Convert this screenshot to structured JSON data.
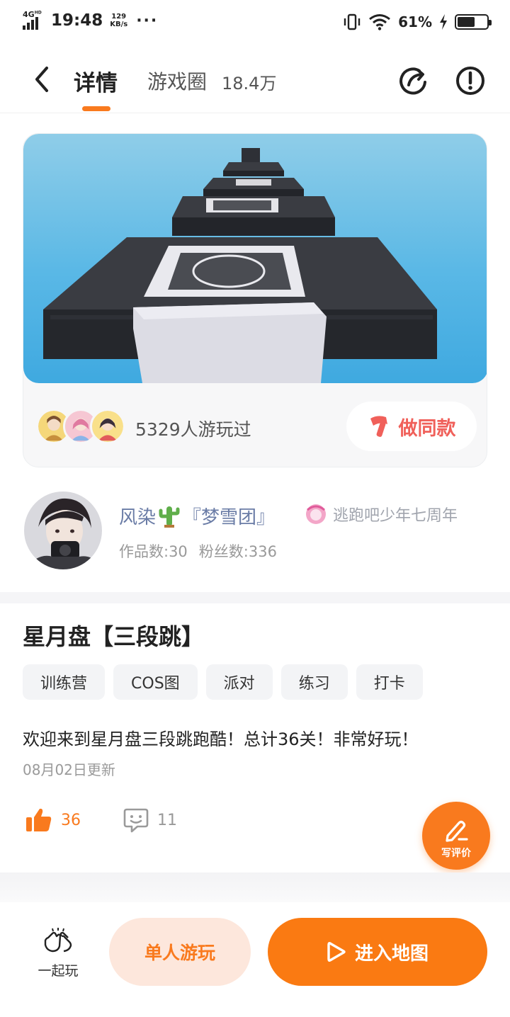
{
  "status_bar": {
    "network": "4G",
    "hd": "HD",
    "time": "19:48",
    "speed_value": "129",
    "speed_unit": "KB/s",
    "dots": "···",
    "battery": "61%",
    "battery_level": 0.61
  },
  "header": {
    "tab_detail": "详情",
    "tab_circle": "游戏圈",
    "tab_circle_count": "18.4万"
  },
  "card": {
    "played_text": "5329人游玩过",
    "same_button": "做同款"
  },
  "author": {
    "name_part1": "风染",
    "name_part2": "『梦雪团』",
    "badge_text": "逃跑吧少年七周年",
    "works": "作品数:30",
    "fans": "粉丝数:336"
  },
  "game": {
    "title": "星月盘【三段跳】",
    "tags": [
      "训练营",
      "COS图",
      "派对",
      "练习",
      "打卡"
    ],
    "description": "欢迎来到星月盘三段跳跑酷！总计36关！非常好玩！",
    "updated": "08月02日更新",
    "likes": "36",
    "comments": "11",
    "write_review": "写评价"
  },
  "bottom": {
    "together": "一起玩",
    "solo": "单人游玩",
    "enter_map": "进入地图"
  },
  "colors": {
    "accent": "#f97a1e",
    "enter_button": "#fa7a12",
    "solo_button_bg": "#fde7dc",
    "same_text": "#f0605a",
    "author_name": "#6a7ca6"
  }
}
